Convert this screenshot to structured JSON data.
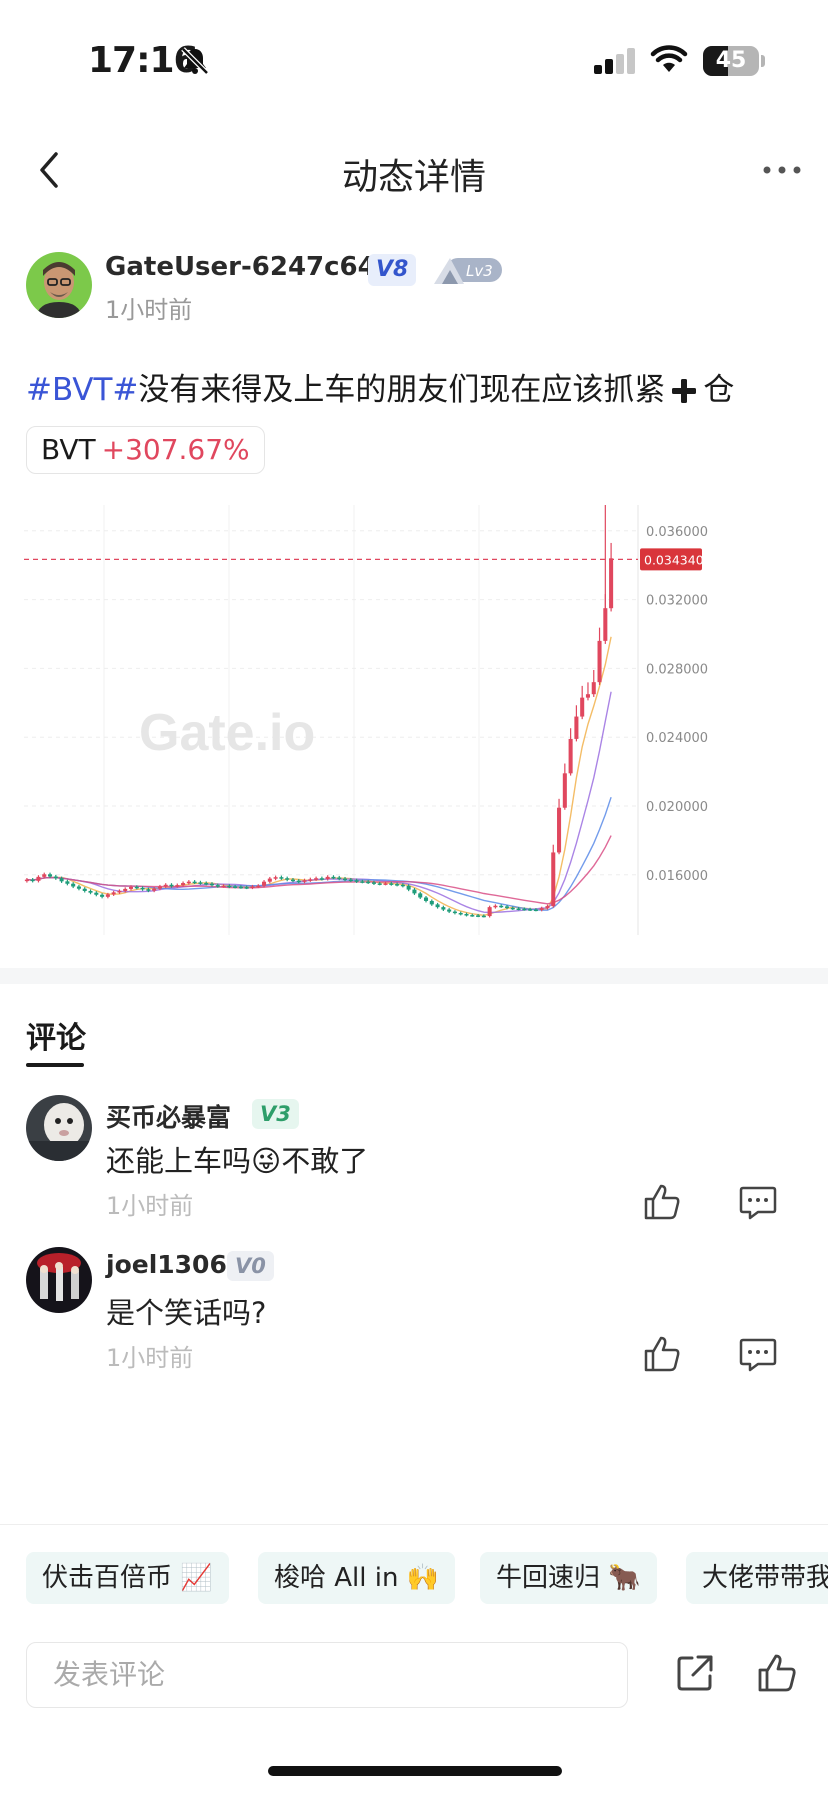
{
  "status_bar": {
    "time": "17:16",
    "battery": "45",
    "battery_level": 0.45
  },
  "nav": {
    "title": "动态详情"
  },
  "post": {
    "author": "GateUser-6247c64d",
    "vip_badge": "V8",
    "level_badge": "Lv3",
    "time": "1小时前",
    "tag": "#BVT#",
    "text": "没有来得及上车的朋友们现在应该抓紧",
    "text_tail": "仓",
    "coin": {
      "symbol": "BVT",
      "change": "+307.67%"
    }
  },
  "chart_data": {
    "type": "candlestick",
    "y_ticks": [
      "0.036000",
      "0.032000",
      "0.028000",
      "0.024000",
      "0.020000",
      "0.016000"
    ],
    "ylim": [
      0.0125,
      0.0375
    ],
    "current_price": 0.03434,
    "current_price_label": "0.034340",
    "watermark": "Gate.io",
    "candles_close": [
      0.01572,
      0.01565,
      0.01588,
      0.01603,
      0.0159,
      0.0158,
      0.01562,
      0.01548,
      0.01532,
      0.01519,
      0.01506,
      0.01496,
      0.01484,
      0.01472,
      0.01486,
      0.01498,
      0.01506,
      0.01518,
      0.0153,
      0.01524,
      0.01516,
      0.01508,
      0.0152,
      0.01532,
      0.01542,
      0.01534,
      0.0154,
      0.01552,
      0.0156,
      0.01556,
      0.01552,
      0.01548,
      0.0154,
      0.01534,
      0.01536,
      0.01532,
      0.0153,
      0.01528,
      0.01526,
      0.01532,
      0.01536,
      0.0156,
      0.01578,
      0.01586,
      0.0158,
      0.01572,
      0.01566,
      0.0156,
      0.01568,
      0.01574,
      0.0158,
      0.01576,
      0.01588,
      0.01584,
      0.01578,
      0.01572,
      0.01568,
      0.01562,
      0.0156,
      0.01556,
      0.0155,
      0.01548,
      0.0155,
      0.01546,
      0.01542,
      0.01536,
      0.01514,
      0.01492,
      0.01468,
      0.01448,
      0.01428,
      0.01412,
      0.01398,
      0.01386,
      0.01378,
      0.01372,
      0.01366,
      0.01364,
      0.01362,
      0.0136,
      0.01412,
      0.0142,
      0.01416,
      0.01408,
      0.01404,
      0.01402,
      0.014,
      0.01398,
      0.01396,
      0.01406,
      0.01418,
      0.0173,
      0.0199,
      0.0219,
      0.0239,
      0.0252,
      0.0263,
      0.0265,
      0.0272,
      0.0296,
      0.0315,
      0.0344
    ]
  },
  "comments_tab": "评论",
  "comments": [
    {
      "user": "买币必暴富",
      "badge": "V3",
      "badge_color": "#2e9e6a",
      "badge_bg": "#e6f6ef",
      "text": "还能上车吗",
      "emoji": "😜",
      "text_tail": "不敢了",
      "time": "1小时前"
    },
    {
      "user": "joel1306",
      "badge": "V0",
      "badge_color": "#8a93a6",
      "badge_bg": "#eef0f4",
      "text": "是个笑话吗?",
      "emoji": "",
      "text_tail": "",
      "time": "1小时前"
    }
  ],
  "quick_replies": [
    "伏击百倍币 📈",
    "梭哈 All in 🙌",
    "牛回速归 🐂",
    "大佬带带我"
  ],
  "input": {
    "placeholder": "发表评论"
  },
  "colors": {
    "accent": "#3a55d6",
    "up": "#e0475e",
    "down": "#1f9d7a"
  }
}
